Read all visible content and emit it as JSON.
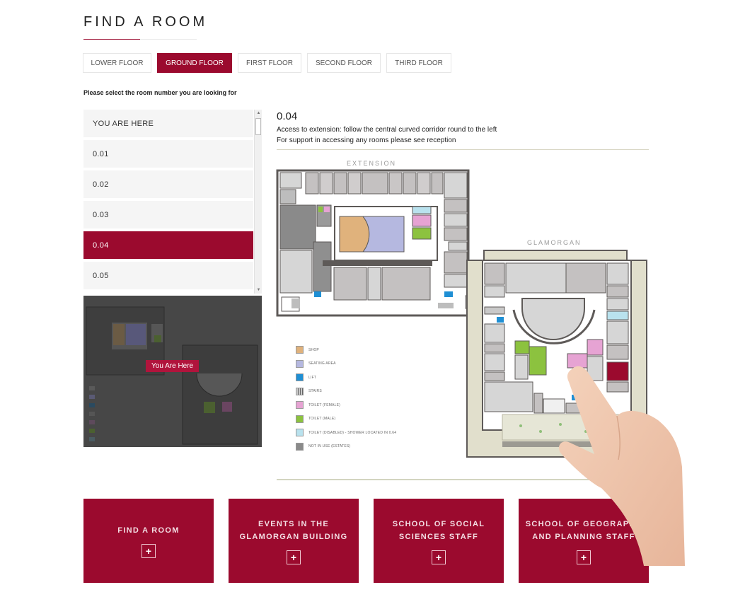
{
  "page": {
    "title": "FIND A ROOM",
    "accent_color": "#9b0a2e"
  },
  "tabs": [
    {
      "label": "LOWER FLOOR",
      "active": false
    },
    {
      "label": "GROUND FLOOR",
      "active": true
    },
    {
      "label": "FIRST FLOOR",
      "active": false
    },
    {
      "label": "SECOND FLOOR",
      "active": false
    },
    {
      "label": "THIRD FLOOR",
      "active": false
    }
  ],
  "instruction": "Please select the room number you are looking for",
  "room_list": {
    "items": [
      {
        "label": "YOU ARE HERE",
        "selected": false
      },
      {
        "label": "0.01",
        "selected": false
      },
      {
        "label": "0.02",
        "selected": false
      },
      {
        "label": "0.03",
        "selected": false
      },
      {
        "label": "0.04",
        "selected": true
      },
      {
        "label": "0.05",
        "selected": false
      }
    ]
  },
  "mini_map": {
    "marker_label": "You Are Here"
  },
  "detail": {
    "room": "0.04",
    "line1": "Access to extension: follow the central curved corridor round to the left",
    "line2": "For support in accessing any rooms please see reception"
  },
  "map": {
    "labels": {
      "extension": "EXTENSION",
      "glamorgan": "GLAMORGAN"
    },
    "highlighted_room": "0.04",
    "legend": [
      {
        "label": "SHOP",
        "color": "#e0b27c"
      },
      {
        "label": "SEATING AREA",
        "color": "#b5b8e0"
      },
      {
        "label": "LIFT",
        "color": "#1f8fd4"
      },
      {
        "label": "STAIRS",
        "color": "#c9c9c9"
      },
      {
        "label": "TOILET (FEMALE)",
        "color": "#e6a3d3"
      },
      {
        "label": "TOILET (MALE)",
        "color": "#8cc23f"
      },
      {
        "label": "TOILET (DISABLED) - SHOWER LOCATED IN 0.64",
        "color": "#b9e2ee"
      },
      {
        "label": "NOT IN USE (ESTATES)",
        "color": "#8a8a8a"
      }
    ]
  },
  "cards": [
    {
      "line1": "FIND A ROOM",
      "line2": ""
    },
    {
      "line1": "EVENTS IN THE",
      "line2": "GLAMORGAN BUILDING"
    },
    {
      "line1": "SCHOOL OF SOCIAL",
      "line2": "SCIENCES STAFF"
    },
    {
      "line1": "SCHOOL OF GEOGRAPHY",
      "line2": "AND PLANNING STAFF"
    }
  ],
  "icons": {
    "plus": "+",
    "scroll_up": "▲",
    "scroll_down": "▼"
  }
}
